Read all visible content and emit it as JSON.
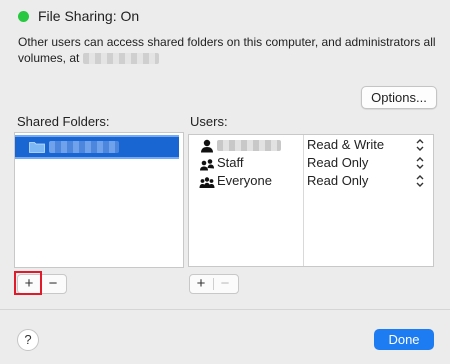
{
  "header": {
    "status_title": "File Sharing: On",
    "status_color": "#28c840",
    "description": "Other users can access shared folders on this computer, and administrators all volumes, at"
  },
  "options_button": {
    "label": "Options..."
  },
  "shared_folders": {
    "label": "Shared Folders:",
    "add_label": "+",
    "remove_label": "−"
  },
  "users": {
    "label": "Users:",
    "rows": [
      {
        "name": "",
        "permission": "Read & Write",
        "icon": "user-icon"
      },
      {
        "name": "Staff",
        "permission": "Read Only",
        "icon": "group-icon"
      },
      {
        "name": "Everyone",
        "permission": "Read Only",
        "icon": "everyone-icon"
      }
    ],
    "add_label": "+",
    "remove_label": "−"
  },
  "footer": {
    "help_label": "?",
    "done_label": "Done",
    "accent_color": "#1e7cf2"
  },
  "highlight_color": "#e0192b"
}
